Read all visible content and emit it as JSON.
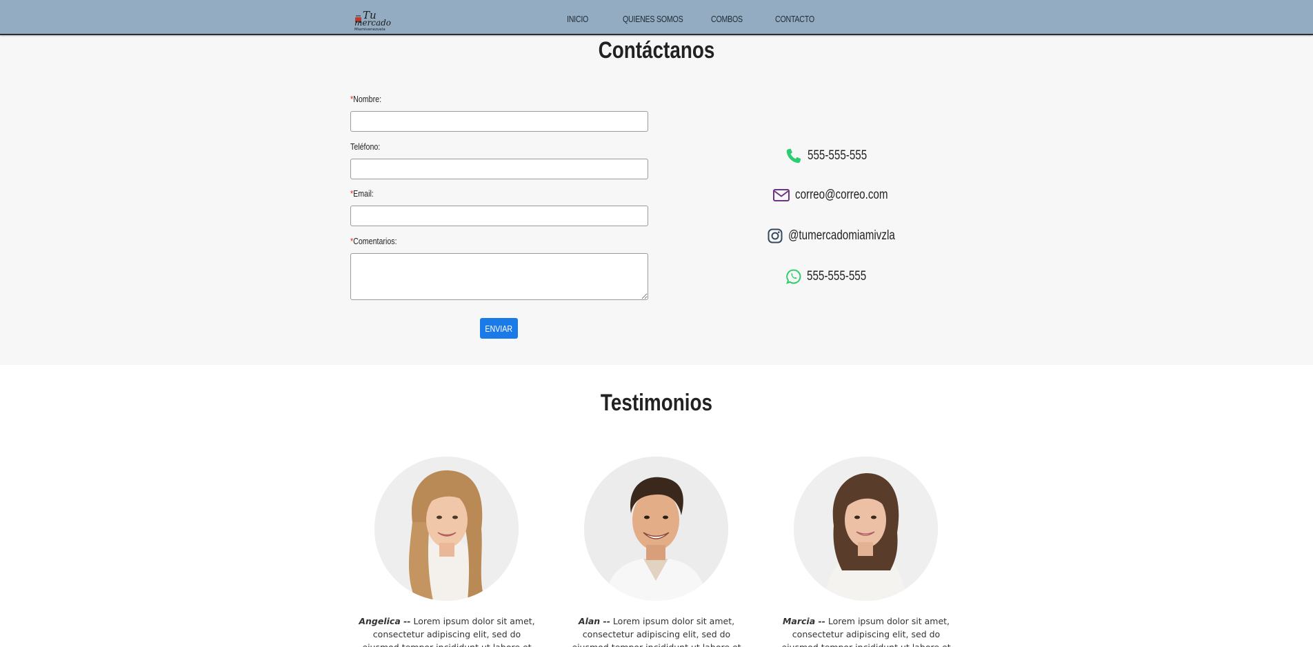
{
  "brand": {
    "logo_line1": "Tu",
    "logo_line2": "mercado",
    "logo_line3": "Miamivenezuela"
  },
  "nav": {
    "items": [
      "INICIO",
      "QUIENES SOMOS",
      "COMBOS",
      "CONTACTO"
    ]
  },
  "contact": {
    "title": "Contáctanos",
    "form": {
      "name_label": "Nombre:",
      "phone_label": "Teléfono:",
      "email_label": "Email:",
      "comments_label": "Comentarios:",
      "required_mark": "*",
      "name_value": "",
      "phone_value": "",
      "email_value": "",
      "comments_value": "",
      "submit_label": "ENVIAR"
    },
    "info": {
      "phone": "555-555-555",
      "email": "correo@correo.com",
      "instagram": "@tumercadomiamivzla",
      "whatsapp": "555-555-555"
    }
  },
  "testimonials": {
    "title": "Testimonios",
    "items": [
      {
        "name": "Angelica --",
        "text": "Lorem ipsum dolor sit amet, consectetur adipiscing elit, sed do eiusmod tempor incididunt ut labore et dolore"
      },
      {
        "name": "Alan --",
        "text": "Lorem ipsum dolor sit amet, consectetur adipiscing elit, sed do eiusmod tempor incididunt ut labore et dolore magna aliqua"
      },
      {
        "name": "Marcia --",
        "text": "Lorem ipsum dolor sit amet, consectetur adipiscing elit, sed do eiusmod tempor incididunt ut labore et dolore"
      }
    ]
  },
  "colors": {
    "navbar": "#93acc2",
    "section_bg": "#f7f7f7",
    "button": "#1a7ae8",
    "phone_icon": "#2ecc71",
    "email_icon": "#6c3483",
    "instagram_icon": "#34495e",
    "whatsapp_icon": "#2ecc71",
    "required": "#d9230f"
  },
  "icons": {
    "phone": "phone-icon",
    "email": "envelope-icon",
    "instagram": "instagram-icon",
    "whatsapp": "whatsapp-icon"
  }
}
